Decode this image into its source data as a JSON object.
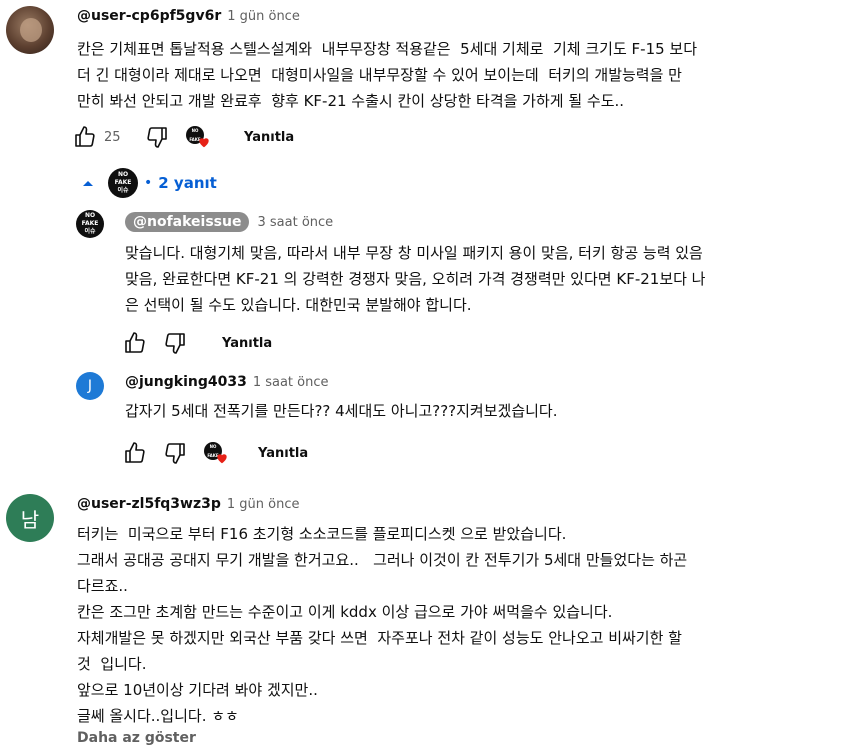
{
  "comments": [
    {
      "handle": "@user-cp6pf5gv6r",
      "time": "1 gün önce",
      "text": "칸은 기체표면 톱날적용 스텔스설계와  내부무장창 적용같은  5세대 기체로  기체 크기도 F-15 보다\n더 긴 대형이라 제대로 나오면  대형미사일을 내부무장할 수 있어 보이는데  터키의 개발능력을 만\n만히 봐선 안되고 개발 완료후  향후 KF-21 수출시 칸이 상당한 타격을 가하게 될 수도..",
      "likes": "25",
      "reply_label": "Yanıtla",
      "replies_toggle": "2 yanıt"
    },
    {
      "handle": "@user-zl5fq3wz3p",
      "time": "1 gün önce",
      "avatar_letter": "남",
      "avatar_color": "#2e7d57",
      "text": "터키는  미국으로 부터 F16 초기형 소소코드를 플로피디스켓 으로 받았습니다.\n그래서 공대공 공대지 무기 개발을 한거고요..   그러나 이것이 칸 전투기가 5세대 만들었다는 하곤\n다르죠..\n칸은 조그만 초계함 만드는 수준이고 이게 kddx 이상 급으로 가야 써먹을수 있습니다.\n자체개발은 못 하겠지만 외국산 부품 갖다 쓰면  자주포나 전차 같이 성능도 안나오고 비싸기한 할\n것  입니다.\n앞으로 10년이상 기다려 봐야 겠지만..\n글쎄 올시다..입니다. ㅎㅎ",
      "show_less": "Daha az göster"
    }
  ],
  "replies": [
    {
      "handle": "@nofakeissue",
      "time": "3 saat önce",
      "text": "맞습니다. 대형기체 맞음, 따라서 내부 무장 창 미사일 패키지 용이 맞음, 터키 항공 능력 있음\n맞음, 완료한다면 KF-21 의 강력한 경쟁자 맞음, 오히려 가격 경쟁력만 있다면 KF-21보다 나\n은 선택이 될 수도 있습니다. 대한민국 분발해야 합니다.",
      "reply_label": "Yanıtla"
    },
    {
      "handle": "@jungking4033",
      "time": "1 saat önce",
      "avatar_letter": "J",
      "avatar_color": "#1e7ad6",
      "text": "갑자기 5세대 전폭기를 만든다?? 4세대도 아니고???지켜보겠습니다.",
      "reply_label": "Yanıtla"
    }
  ],
  "badge": {
    "line1": "NO",
    "line2": "FAKE",
    "line3": "이슈"
  },
  "colors": {
    "link_blue": "#065fd4",
    "heart_red": "#e62117"
  }
}
